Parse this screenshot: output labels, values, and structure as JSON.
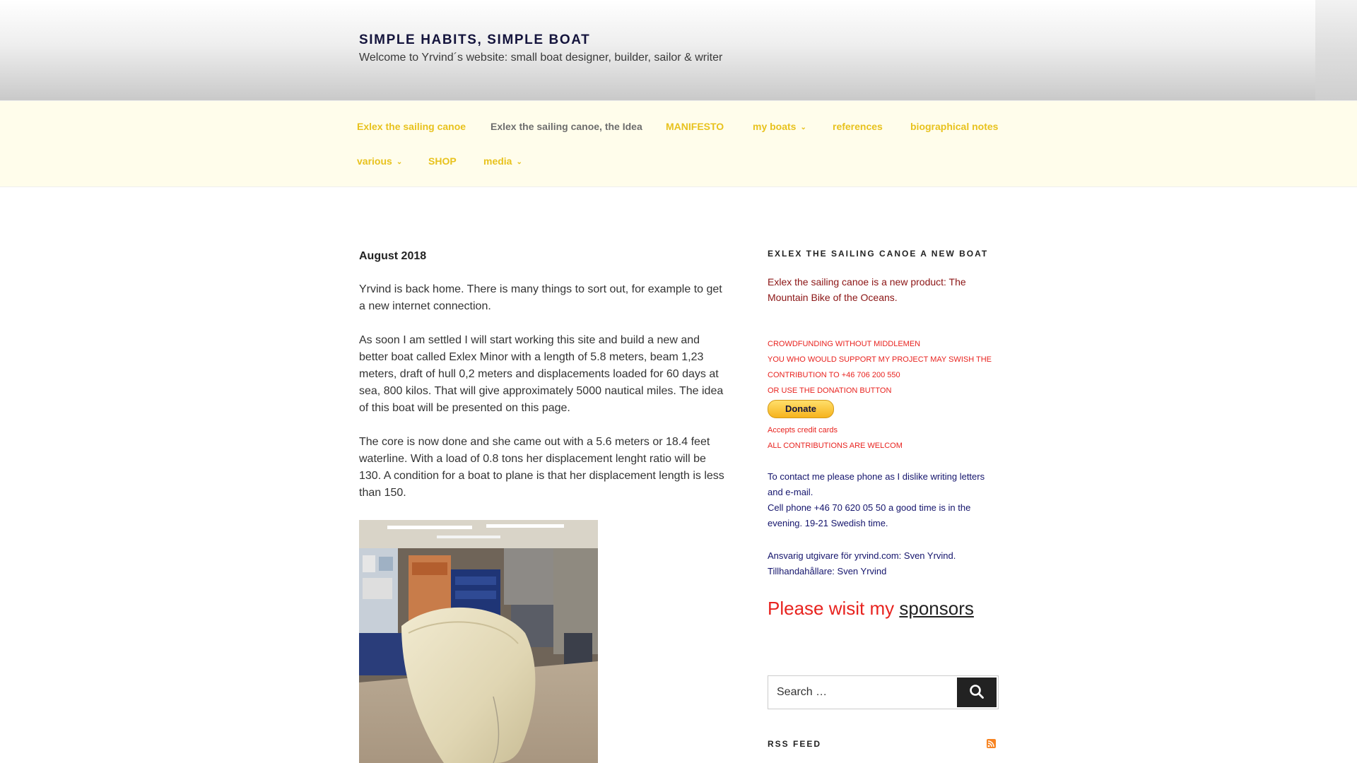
{
  "header": {
    "site_title": "SIMPLE HABITS, SIMPLE BOAT",
    "site_description": "Welcome to Yrvind´s website: small boat designer, builder, sailor & writer"
  },
  "nav": {
    "items": [
      {
        "label": "Exlex the sailing canoe",
        "current": false,
        "has_submenu": false
      },
      {
        "label": "Exlex the sailing canoe, the Idea",
        "current": true,
        "has_submenu": false
      },
      {
        "label": "MANIFESTO",
        "current": false,
        "has_submenu": false
      },
      {
        "label": "my boats",
        "current": false,
        "has_submenu": true
      },
      {
        "label": "references",
        "current": false,
        "has_submenu": false
      },
      {
        "label": "biographical notes",
        "current": false,
        "has_submenu": false
      },
      {
        "label": "various",
        "current": false,
        "has_submenu": true
      },
      {
        "label": "SHOP",
        "current": false,
        "has_submenu": false
      },
      {
        "label": "media",
        "current": false,
        "has_submenu": true
      }
    ]
  },
  "main": {
    "date_heading": "August 2018",
    "paragraphs": [
      "Yrvind is back home. There is many things to sort out, for example to get a new internet connection.",
      "As soon I am settled I will start working this site and build a new and better boat called Exlex Minor with a length of 5.8 meters, beam 1,23 meters, draft of hull 0,2 meters and displacements loaded for 60 days at sea, 800 kilos. That will give approximately 5000 nautical miles. The idea of this boat will be presented on this page.",
      "The core is now done and she came out with a 5.6 meters or 18.4 feet waterline. With a load of 0.8 tons her displacement lenght ratio will be 130. A condition for a boat to plane is that her displacement length is less than 150."
    ]
  },
  "sidebar": {
    "widget_title": "EXLEX THE SAILING CANOE A NEW BOAT",
    "intro": "Exlex the sailing canoe is a new product: The Mountain Bike of the Oceans.",
    "crowdfunding_lines": [
      "CROWDFUNDING WITHOUT MIDDLEMEN",
      "YOU WHO WOULD SUPPORT MY PROJECT MAY SWISH THE",
      "CONTRIBUTION TO +46 706 200 550",
      "OR USE THE DONATION BUTTON"
    ],
    "donate_label": "Donate",
    "accepts_cards": "Accepts credit cards",
    "contributions_welcome": "ALL CONTRIBUTIONS ARE WELCOM",
    "contact_lines": [
      "To contact me please phone as I dislike writing letters and e-mail.",
      "Cell phone +46 70 620 05 50 a good time is in the evening. 19-21 Swedish time."
    ],
    "publisher_lines": [
      "Ansvarig utgivare för yrvind.com: Sven Yrvind.",
      "Tillhandahållare: Sven Yrvind"
    ],
    "sponsors_prefix": "Please wisit my",
    "sponsors_link": "sponsors",
    "search_placeholder": "Search …",
    "rss_title": "RSS FEED"
  },
  "colors": {
    "nav_background": "#fffdeb",
    "nav_link": "#e8c21d",
    "nav_current": "#6d6d6d",
    "sidebar_red": "#e8231f",
    "sidebar_dark_red": "#8b1414",
    "sidebar_navy": "#14146c",
    "search_button": "#222222",
    "rss_orange": "#f78422"
  }
}
